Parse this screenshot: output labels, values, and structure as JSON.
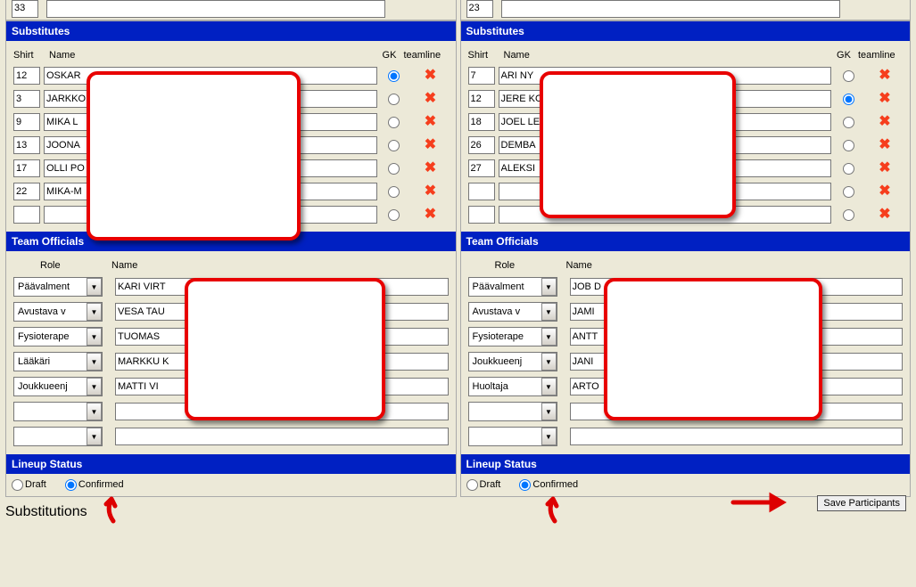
{
  "left": {
    "top_num": "33",
    "top_name": "",
    "substitutes_header": "Substitutes",
    "headers": {
      "shirt": "Shirt",
      "name": "Name",
      "gk": "GK",
      "team": "teamline"
    },
    "subs": [
      {
        "shirt": "12",
        "name": "OSKAR",
        "gk": true
      },
      {
        "shirt": "3",
        "name": "JARKKO",
        "gk": false
      },
      {
        "shirt": "9",
        "name": "MIKA L",
        "gk": false
      },
      {
        "shirt": "13",
        "name": "JOONA",
        "gk": false
      },
      {
        "shirt": "17",
        "name": "OLLI PO",
        "gk": false
      },
      {
        "shirt": "22",
        "name": "MIKA-M",
        "gk": false
      },
      {
        "shirt": "",
        "name": "",
        "gk": false
      }
    ],
    "officials_header": "Team Officials",
    "off_headers": {
      "role": "Role",
      "name": "Name"
    },
    "officials": [
      {
        "role": "Päävalment",
        "name": "KARI VIRT"
      },
      {
        "role": "Avustava v",
        "name": "VESA TAU"
      },
      {
        "role": "Fysioterape",
        "name": "TUOMAS"
      },
      {
        "role": "Lääkäri",
        "name": "MARKKU K"
      },
      {
        "role": "Joukkueenj",
        "name": "MATTI VI"
      },
      {
        "role": "",
        "name": ""
      },
      {
        "role": "",
        "name": ""
      }
    ],
    "lineup_header": "Lineup Status",
    "lineup": {
      "draft": "Draft",
      "confirmed": "Confirmed",
      "selected": "confirmed"
    }
  },
  "right": {
    "top_num": "23",
    "top_name": "",
    "substitutes_header": "Substitutes",
    "headers": {
      "shirt": "Shirt",
      "name": "Name",
      "gk": "GK",
      "team": "teamline"
    },
    "subs": [
      {
        "shirt": "7",
        "name": "ARI NY",
        "gk": false
      },
      {
        "shirt": "12",
        "name": "JERE KO",
        "gk": true
      },
      {
        "shirt": "18",
        "name": "JOEL LE",
        "gk": false
      },
      {
        "shirt": "26",
        "name": "DEMBA",
        "gk": false
      },
      {
        "shirt": "27",
        "name": "ALEKSI",
        "gk": false
      },
      {
        "shirt": "",
        "name": "",
        "gk": false
      },
      {
        "shirt": "",
        "name": "",
        "gk": false
      }
    ],
    "officials_header": "Team Officials",
    "off_headers": {
      "role": "Role",
      "name": "Name"
    },
    "officials": [
      {
        "role": "Päävalment",
        "name": "JOB D"
      },
      {
        "role": "Avustava v",
        "name": "JAMI"
      },
      {
        "role": "Fysioterape",
        "name": "ANTT"
      },
      {
        "role": "Joukkueenj",
        "name": "JANI"
      },
      {
        "role": "Huoltaja",
        "name": "ARTO"
      },
      {
        "role": "",
        "name": ""
      },
      {
        "role": "",
        "name": ""
      }
    ],
    "lineup_header": "Lineup Status",
    "lineup": {
      "draft": "Draft",
      "confirmed": "Confirmed",
      "selected": "confirmed"
    }
  },
  "save_button": "Save Participants",
  "substitutions_label": "Substitutions"
}
